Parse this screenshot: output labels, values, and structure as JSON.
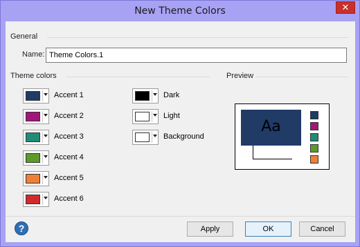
{
  "window": {
    "title": "New Theme Colors",
    "close_glyph": "✕"
  },
  "general": {
    "section_label": "General",
    "name_label": "Name:",
    "name_value": "Theme Colors.1"
  },
  "theme_colors": {
    "section_label": "Theme colors",
    "accents": [
      {
        "label": "Accent 1",
        "color": "#1f3b66"
      },
      {
        "label": "Accent 2",
        "color": "#a3157b"
      },
      {
        "label": "Accent 3",
        "color": "#1e8c77"
      },
      {
        "label": "Accent 4",
        "color": "#5c9b2b"
      },
      {
        "label": "Accent 5",
        "color": "#ee7f38"
      },
      {
        "label": "Accent 6",
        "color": "#d12a2e"
      }
    ],
    "base": [
      {
        "label": "Dark",
        "color": "#000000"
      },
      {
        "label": "Light",
        "color": "#ffffff"
      },
      {
        "label": "Background",
        "color": "#ffffff"
      }
    ]
  },
  "preview": {
    "section_label": "Preview",
    "sample_text": "Aa"
  },
  "footer": {
    "help_glyph": "?",
    "apply_label": "Apply",
    "ok_label": "OK",
    "cancel_label": "Cancel"
  },
  "icons": {
    "help": "help-icon",
    "dropdown": "dropdown-arrow-icon",
    "close": "close-icon"
  }
}
